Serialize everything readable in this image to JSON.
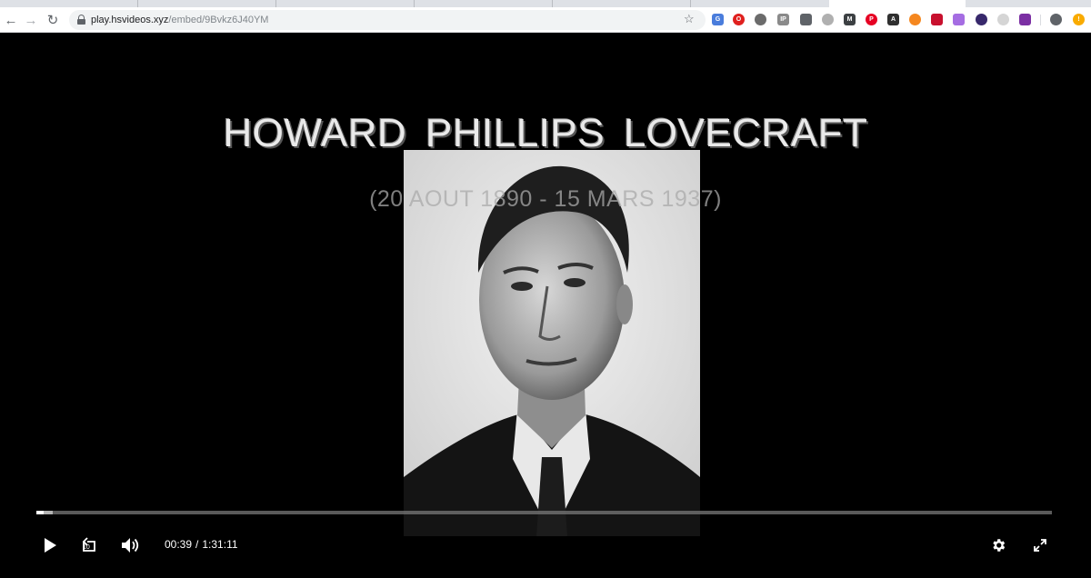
{
  "browser": {
    "url_host": "play.hsvideos.xyz",
    "url_path": "/embed/9Bvkz6J40YM",
    "extensions": [
      {
        "name": "translate-extension-icon",
        "color": "#4a7ddc",
        "glyph": "G",
        "round": false
      },
      {
        "name": "opera-extension-icon",
        "color": "#e0201e",
        "glyph": "O",
        "round": true
      },
      {
        "name": "dice-extension-icon",
        "color": "#6b6b6b",
        "glyph": "",
        "round": true
      },
      {
        "name": "ip-extension-icon",
        "color": "#8a8a8a",
        "glyph": "IP",
        "round": false
      },
      {
        "name": "eyedropper-extension-icon",
        "color": "#5f6368",
        "glyph": "",
        "round": false
      },
      {
        "name": "grey-circle-extension-icon",
        "color": "#b0b0b0",
        "glyph": "",
        "round": true
      },
      {
        "name": "m-extension-icon",
        "color": "#3c4043",
        "glyph": "M",
        "round": false
      },
      {
        "name": "pinterest-extension-icon",
        "color": "#e60023",
        "glyph": "P",
        "round": true
      },
      {
        "name": "a-extension-icon",
        "color": "#2f2f2f",
        "glyph": "A",
        "round": false
      },
      {
        "name": "orange-extension-icon",
        "color": "#f5871f",
        "glyph": "",
        "round": true
      },
      {
        "name": "vivaldi-extension-icon",
        "color": "#c8102e",
        "glyph": "",
        "round": false
      },
      {
        "name": "purple-extension-icon",
        "color": "#a56de2",
        "glyph": "",
        "round": false
      },
      {
        "name": "dark-circle-extension-icon",
        "color": "#37286b",
        "glyph": "",
        "round": true
      },
      {
        "name": "pale-extension-icon",
        "color": "#d5d5d5",
        "glyph": "",
        "round": true
      },
      {
        "name": "frame-extension-icon",
        "color": "#7b2fa3",
        "glyph": "",
        "round": false
      },
      {
        "name": "profile-icon",
        "color": "#5f6368",
        "glyph": "",
        "round": true
      },
      {
        "name": "update-alert-icon",
        "color": "#f9ab00",
        "glyph": "!",
        "round": true
      }
    ]
  },
  "video": {
    "title": "HOWARD PHILLIPS LOVECRAFT",
    "subtitle": "(20 AOUT 1890 - 15 MARS 1937)"
  },
  "player": {
    "current_time": "00:39",
    "separator": "/",
    "duration": "1:31:11",
    "rewind_label": "10",
    "progress_played": 0.007,
    "progress_buffered": 0.016
  }
}
